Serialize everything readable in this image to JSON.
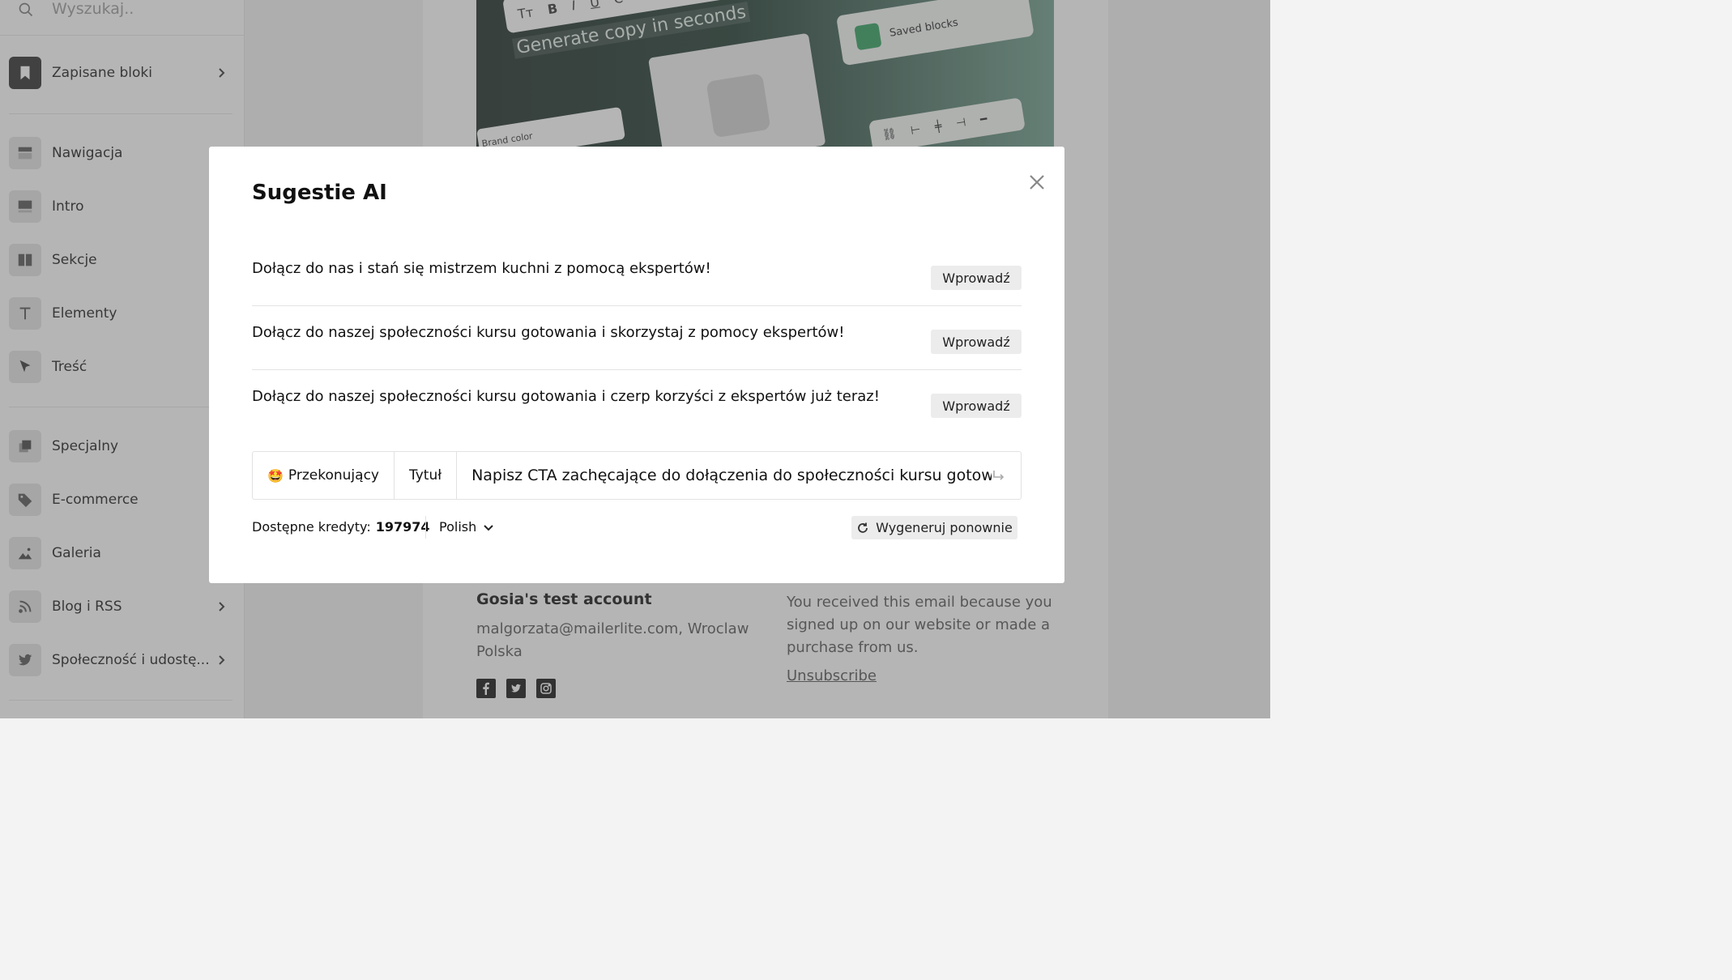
{
  "sidebar": {
    "search_placeholder": "Wyszukaj..",
    "items": [
      {
        "label": "Zapisane bloki",
        "icon": "bookmark-icon",
        "has_chevron": true
      },
      {
        "label": "Nawigacja",
        "icon": "navigation-block-icon",
        "has_chevron": false
      },
      {
        "label": "Intro",
        "icon": "intro-block-icon",
        "has_chevron": false
      },
      {
        "label": "Sekcje",
        "icon": "sections-block-icon",
        "has_chevron": false
      },
      {
        "label": "Elementy",
        "icon": "text-t-icon",
        "has_chevron": false
      },
      {
        "label": "Treść",
        "icon": "cursor-pointer-icon",
        "has_chevron": false
      },
      {
        "label": "Specjalny",
        "icon": "special-block-icon",
        "has_chevron": false
      },
      {
        "label": "E-commerce",
        "icon": "price-tag-icon",
        "has_chevron": false
      },
      {
        "label": "Galeria",
        "icon": "image-icon",
        "has_chevron": false
      },
      {
        "label": "Blog i RSS",
        "icon": "rss-icon",
        "has_chevron": true
      },
      {
        "label": "Społeczność i udostę...",
        "icon": "twitter-bird-icon",
        "has_chevron": true
      }
    ]
  },
  "canvas": {
    "hero": {
      "toolbar_buttons": [
        "Tт",
        "B",
        "I",
        "U",
        "C"
      ],
      "generate_text": "Generate copy in seconds",
      "saved_blocks": "Saved blocks",
      "brand_color": "Brand color"
    },
    "footer": {
      "account_name": "Gosia's test account",
      "address": "malgorzata@mailerlite.com, Wroclaw Polska",
      "note": "You received this email because you signed up on our website or made a purchase from us.",
      "unsubscribe": "Unsubscribe",
      "social_icons": [
        "facebook-icon",
        "twitter-icon",
        "instagram-icon"
      ]
    }
  },
  "modal": {
    "title": "Sugestie AI",
    "suggestions": [
      {
        "text": "Dołącz do nas i stań się mistrzem kuchni z pomocą ekspertów!",
        "button": "Wprowadź"
      },
      {
        "text": "Dołącz do naszej społeczności kursu gotowania i skorzystaj z pomocy ekspertów!",
        "button": "Wprowadź"
      },
      {
        "text": "Dołącz do naszej społeczności kursu gotowania i czerp korzyści z ekspertów już teraz!",
        "button": "Wprowadź"
      }
    ],
    "prompt": {
      "tone_emoji": "🤩",
      "tone": "Przekonujący",
      "type": "Tytuł",
      "value": "Napisz CTA zachęcające do dołączenia do społeczności kursu gotow"
    },
    "credits_label": "Dostępne kredyty:",
    "credits_value": "197974",
    "language": "Polish",
    "regenerate": "Wygeneruj ponownie"
  },
  "colors": {
    "overlay": "#5a5a5a",
    "button_bg": "#ececec",
    "saved_blocks_green": "#2f9e5b",
    "hero_dark": "#1c2a25"
  }
}
